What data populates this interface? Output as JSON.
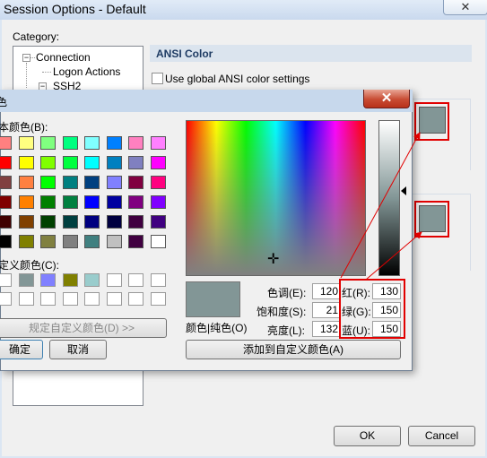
{
  "session_options": {
    "title": "Session Options - Default",
    "close_glyph": "✕",
    "category_label": "Category:",
    "tree": [
      {
        "label": "Connection",
        "toggle": "−"
      },
      {
        "label": "Logon Actions"
      },
      {
        "label": "SSH2",
        "toggle": "−"
      }
    ],
    "section_title": "ANSI Color",
    "use_global_label": "Use global ANSI color settings",
    "buttons": {
      "ok": "OK",
      "cancel": "Cancel"
    }
  },
  "color_dialog": {
    "title": "色",
    "basic_colors_label": "本颜色(B):",
    "custom_colors_label": "定义颜色(C):",
    "define_custom_button": "规定自定义颜色(D) >>",
    "ok_button": "确定",
    "cancel_button": "取消",
    "color_solid_label": "颜色|纯色(O)",
    "hue_label": "色调(E):",
    "hue": "120",
    "sat_label": "饱和度(S):",
    "sat": "21",
    "lum_label": "亮度(L):",
    "lum": "132",
    "red_label": "红(R):",
    "red": "130",
    "green_label": "绿(G):",
    "green": "150",
    "blue_label": "蓝(U):",
    "blue": "150",
    "add_custom_button": "添加到自定义颜色(A)",
    "crosshair": "✛",
    "basic_colors": [
      [
        "#ff8080",
        "#ffff80",
        "#80ff80",
        "#00ff80",
        "#80ffff",
        "#0080ff",
        "#ff80c0",
        "#ff80ff"
      ],
      [
        "#ff0000",
        "#ffff00",
        "#80ff00",
        "#00ff40",
        "#00ffff",
        "#0080c0",
        "#8080c0",
        "#ff00ff"
      ],
      [
        "#804040",
        "#ff8040",
        "#00ff00",
        "#008080",
        "#004080",
        "#8080ff",
        "#800040",
        "#ff0080"
      ],
      [
        "#800000",
        "#ff8000",
        "#008000",
        "#008040",
        "#0000ff",
        "#0000a0",
        "#800080",
        "#8000ff"
      ],
      [
        "#400000",
        "#804000",
        "#004000",
        "#004040",
        "#000080",
        "#000040",
        "#400040",
        "#400080"
      ],
      [
        "#000000",
        "#808000",
        "#808040",
        "#808080",
        "#408080",
        "#c0c0c0",
        "#400040",
        "#ffffff"
      ]
    ],
    "custom_colors": [
      [
        "#ffffff",
        "#829696",
        "#8080ff",
        "#808000",
        "#99cccc",
        "#ffffff",
        "#ffffff",
        "#ffffff"
      ],
      [
        "#ffffff",
        "#ffffff",
        "#ffffff",
        "#ffffff",
        "#ffffff",
        "#ffffff",
        "#ffffff",
        "#ffffff"
      ]
    ],
    "current_color": "#829696"
  }
}
